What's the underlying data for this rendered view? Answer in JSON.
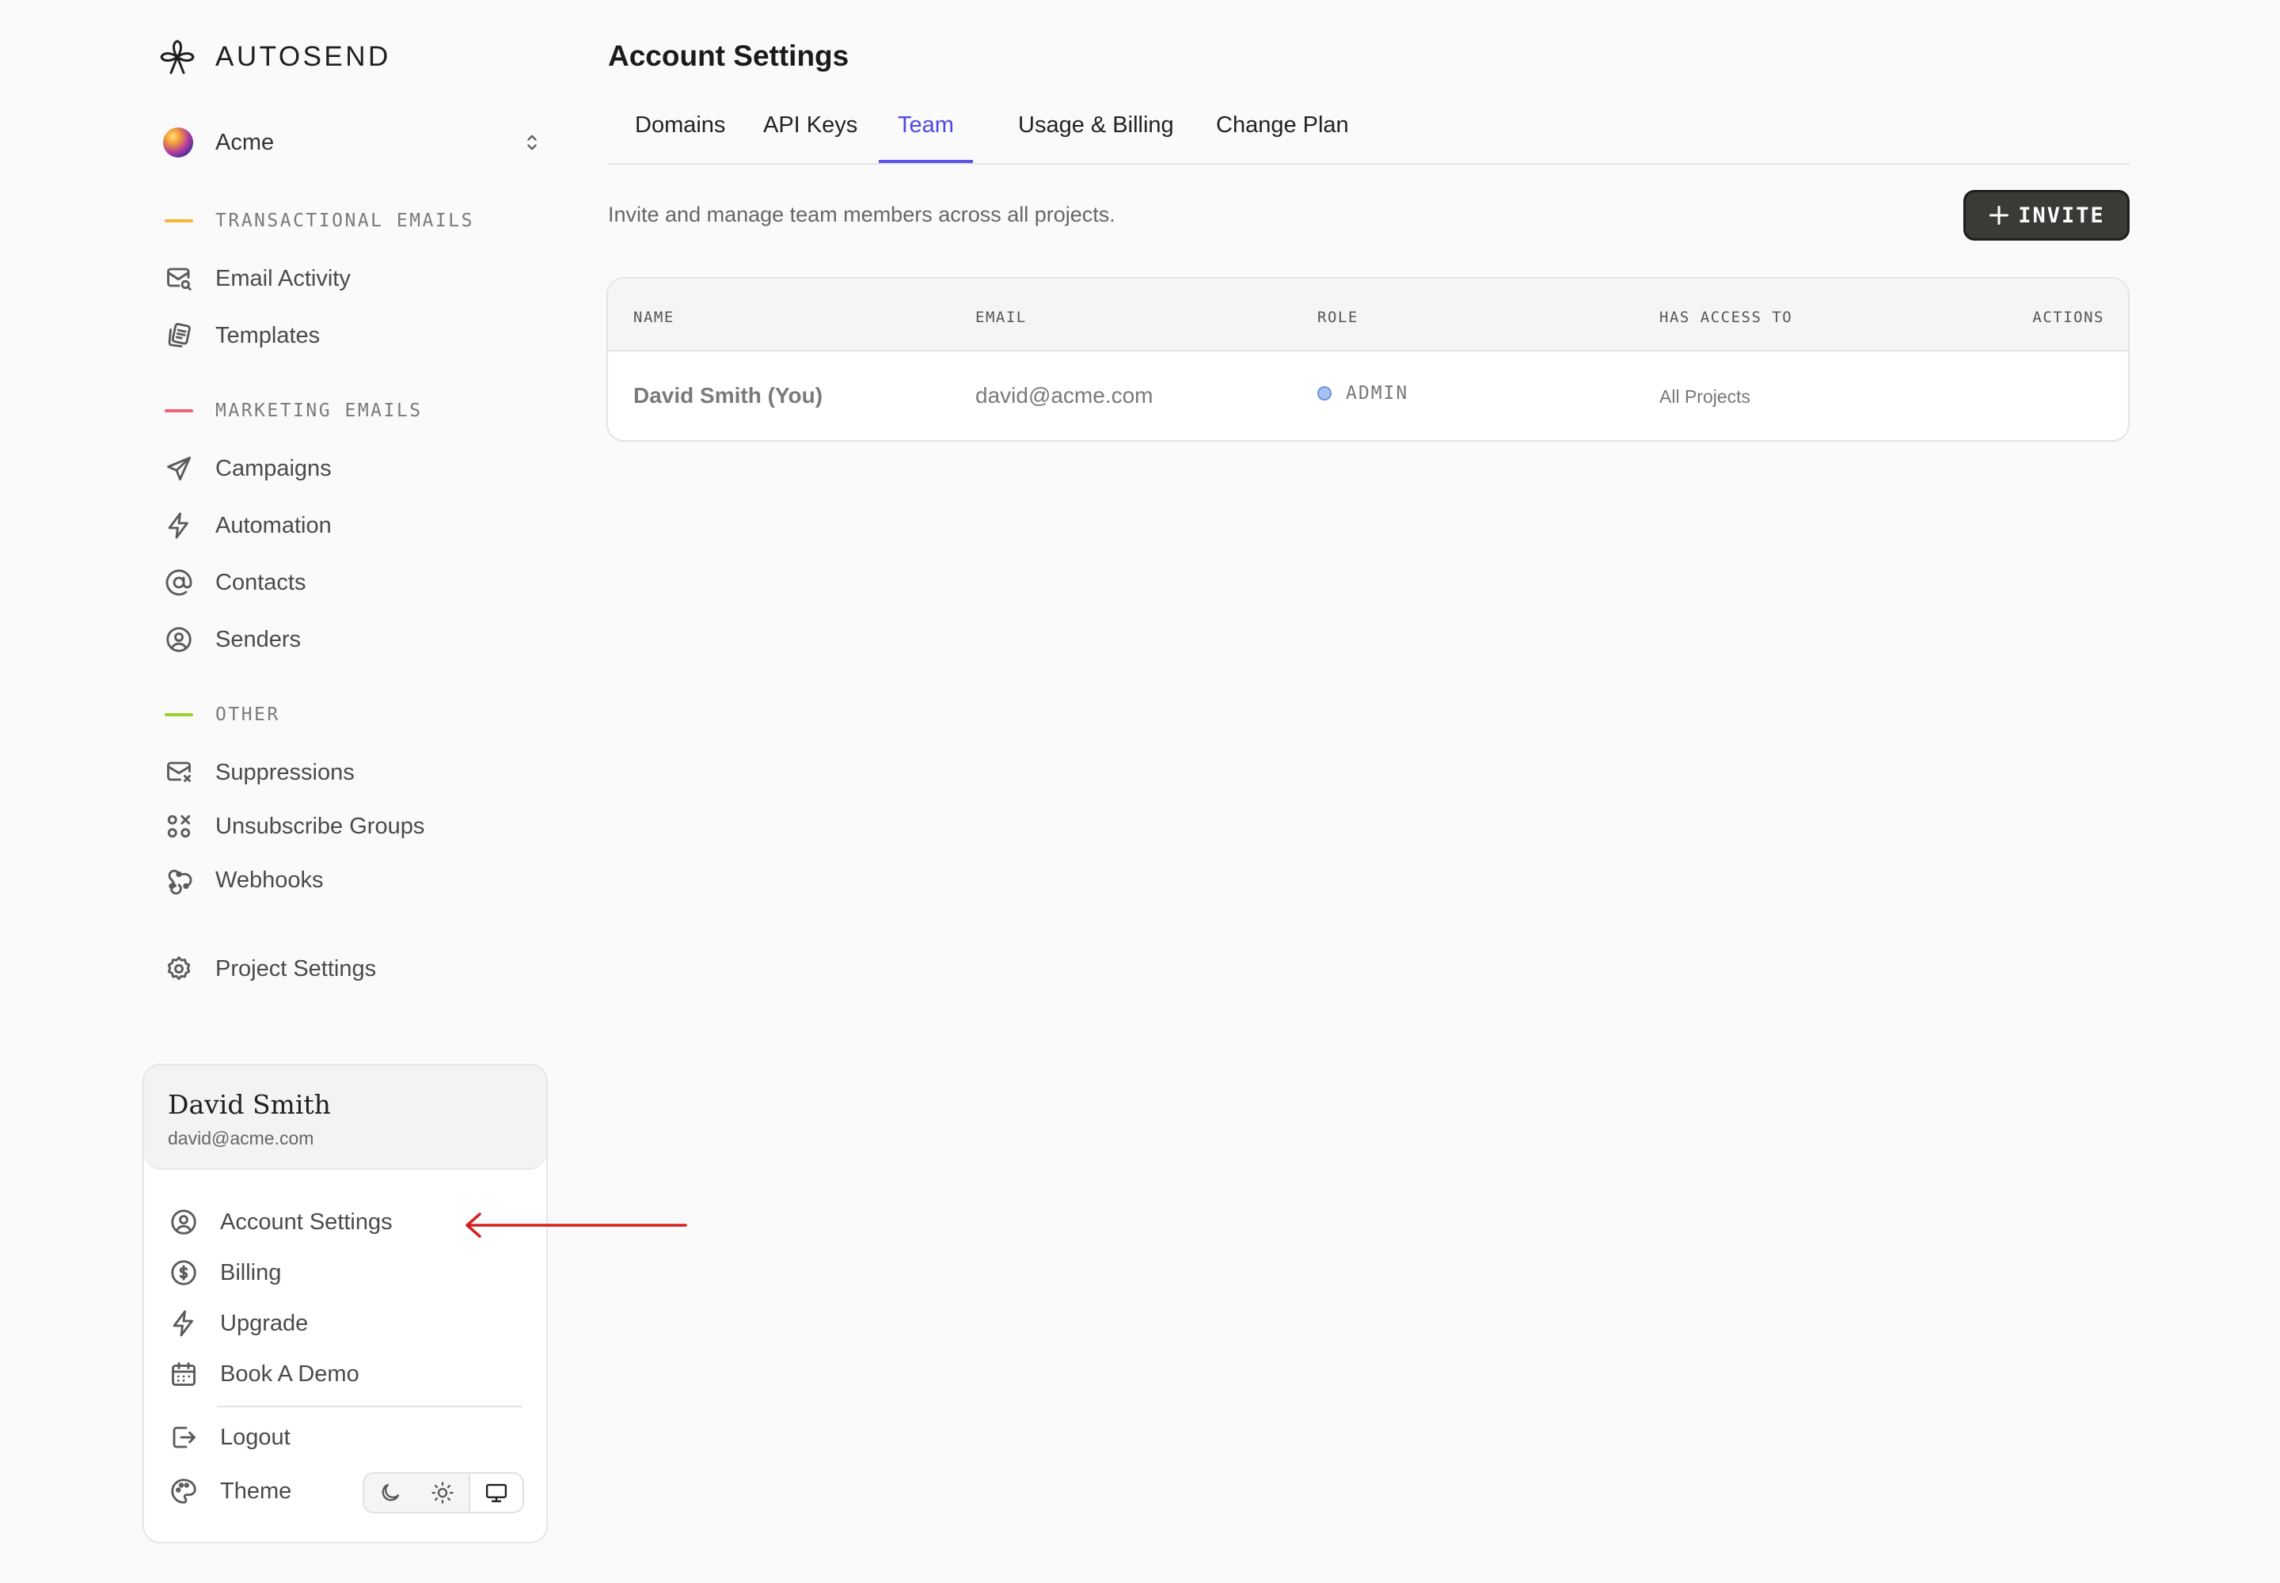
{
  "brand": {
    "name": "AUTOSEND"
  },
  "project": {
    "name": "Acme"
  },
  "sidebar": {
    "sections": [
      {
        "label": "TRANSACTIONAL EMAILS",
        "color": "#f5b731"
      },
      {
        "label": "MARKETING EMAILS",
        "color": "#f0627a"
      },
      {
        "label": "OTHER",
        "color": "#9bd42e"
      }
    ],
    "items": [
      {
        "label": "Email Activity",
        "icon": "mail-search-icon"
      },
      {
        "label": "Templates",
        "icon": "templates-icon"
      },
      {
        "label": "Campaigns",
        "icon": "send-icon"
      },
      {
        "label": "Automation",
        "icon": "bolt-icon"
      },
      {
        "label": "Contacts",
        "icon": "at-icon"
      },
      {
        "label": "Senders",
        "icon": "user-circle-icon"
      },
      {
        "label": "Suppressions",
        "icon": "mail-x-icon"
      },
      {
        "label": "Unsubscribe Groups",
        "icon": "grid-x-icon"
      },
      {
        "label": "Webhooks",
        "icon": "webhook-icon"
      },
      {
        "label": "Project Settings",
        "icon": "gear-icon"
      }
    ]
  },
  "user": {
    "name": "David Smith",
    "email": "david@acme.com",
    "menu": [
      {
        "label": "Account Settings",
        "icon": "user-circle-icon"
      },
      {
        "label": "Billing",
        "icon": "dollar-circle-icon"
      },
      {
        "label": "Upgrade",
        "icon": "bolt-icon"
      },
      {
        "label": "Book A Demo",
        "icon": "calendar-icon"
      },
      {
        "label": "Logout",
        "icon": "logout-icon"
      },
      {
        "label": "Theme",
        "icon": "palette-icon"
      }
    ],
    "theme_options": [
      "dark",
      "light",
      "system"
    ],
    "theme_selected": "system"
  },
  "main": {
    "title": "Account Settings",
    "tabs": [
      {
        "label": "Domains",
        "active": false
      },
      {
        "label": "API Keys",
        "active": false
      },
      {
        "label": "Team",
        "active": true
      },
      {
        "label": "Usage & Billing",
        "active": false
      },
      {
        "label": "Change Plan",
        "active": false
      }
    ],
    "subtitle": "Invite and manage team members across all projects.",
    "invite_label": "INVITE",
    "table": {
      "headers": [
        "NAME",
        "EMAIL",
        "ROLE",
        "HAS ACCESS TO",
        "ACTIONS"
      ],
      "rows": [
        {
          "name": "David Smith (You)",
          "email": "david@acme.com",
          "role": "ADMIN",
          "access": "All Projects"
        }
      ]
    }
  },
  "colors": {
    "accent": "#4f46e5",
    "annotation_arrow": "#d42020"
  }
}
